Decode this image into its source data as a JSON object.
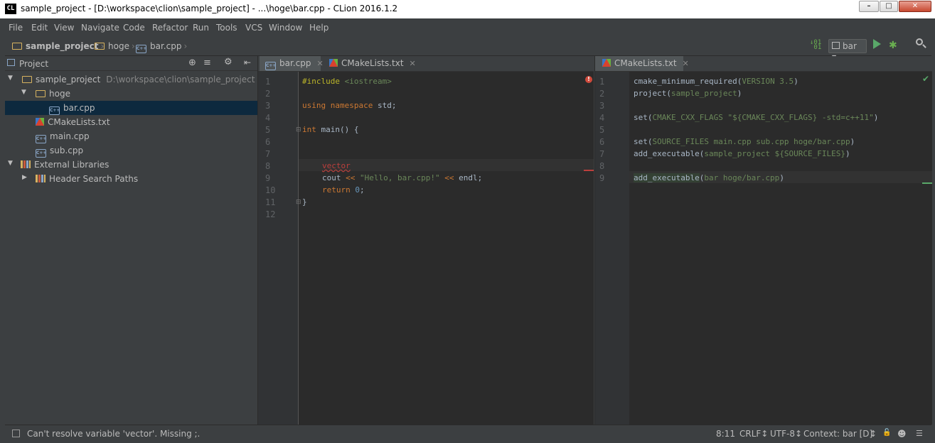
{
  "window": {
    "title": "sample_project - [D:\\workspace\\clion\\sample_project] - ...\\hoge\\bar.cpp - CLion 2016.1.2",
    "app_icon": "CL"
  },
  "menu": [
    "File",
    "Edit",
    "View",
    "Navigate",
    "Code",
    "Refactor",
    "Run",
    "Tools",
    "VCS",
    "Window",
    "Help"
  ],
  "breadcrumb": [
    "sample_project",
    "hoge",
    "bar.cpp"
  ],
  "run_config": "bar",
  "project_panel": {
    "title": "Project",
    "tree": [
      {
        "label": "sample_project",
        "path": "D:\\workspace\\clion\\sample_project"
      },
      {
        "label": "hoge"
      },
      {
        "label": "bar.cpp"
      },
      {
        "label": "CMakeLists.txt"
      },
      {
        "label": "main.cpp"
      },
      {
        "label": "sub.cpp"
      },
      {
        "label": "External Libraries"
      },
      {
        "label": "Header Search Paths"
      }
    ]
  },
  "left_editor": {
    "tabs": [
      "bar.cpp",
      "CMakeLists.txt"
    ],
    "line_numbers": [
      "1",
      "2",
      "3",
      "4",
      "5",
      "6",
      "7",
      "8",
      "9",
      "10",
      "11",
      "12"
    ]
  },
  "right_editor": {
    "tabs": [
      "CMakeLists.txt"
    ],
    "line_numbers": [
      "1",
      "2",
      "3",
      "4",
      "5",
      "6",
      "7",
      "8",
      "9"
    ]
  },
  "status_bar": {
    "message": "Can't resolve variable 'vector'. Missing ;.",
    "position": "8:11",
    "line_sep": "CRLF↕",
    "encoding": "UTF-8↕",
    "context": "Context: bar [D]"
  },
  "colors": {
    "background": "#2b2b2b",
    "panel": "#3c3f41",
    "keyword": "#cc7832",
    "string": "#6a8759",
    "error": "#bc3f3c",
    "selection": "#0d293e"
  }
}
